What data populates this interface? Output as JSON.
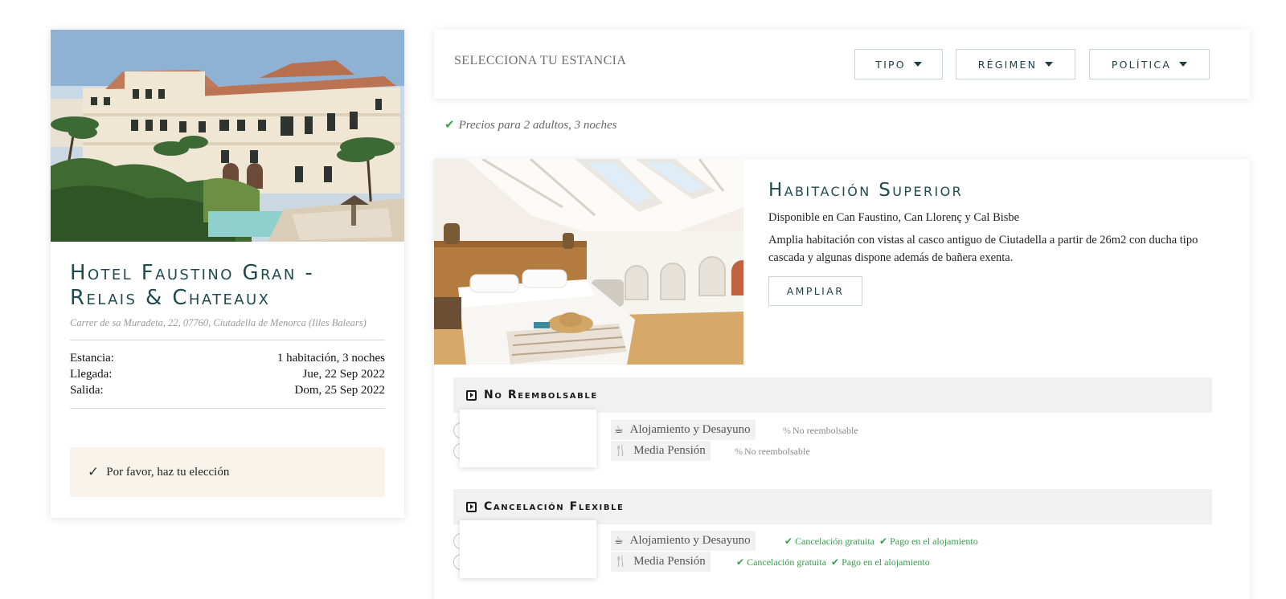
{
  "hotel": {
    "name_line1": "Hotel Faustino Gran -",
    "name_line2": "Relais & Chateaux",
    "address": "Carrer de sa Muradeta, 22, 07760, Ciutadella de Menorca (Illes Balears)",
    "stay": [
      {
        "label": "Estancia:",
        "value": "1 habitación, 3 noches"
      },
      {
        "label": "Llegada:",
        "value": "Jue, 22 Sep 2022"
      },
      {
        "label": "Salida:",
        "value": "Dom, 25 Sep 2022"
      }
    ],
    "choice_prompt": "Por favor, haz tu elección"
  },
  "selector": {
    "title": "SELECCIONA TU ESTANCIA",
    "filters": [
      "TIPO",
      "RÉGIMEN",
      "POLÍTICA"
    ]
  },
  "prices_note": "Precios para 2 adultos, 3 noches",
  "room": {
    "title": "Habitación Superior",
    "availability": "Disponible en Can Faustino, Can Llorenç y Cal Bisbe",
    "description": "Amplia habitación con vistas al casco antiguo de Ciutadella a partir de 26m2 con ducha tipo cascada y algunas dispone además de bañera exenta.",
    "expand_label": "AMPLIAR"
  },
  "policies": [
    {
      "title": "No Reembolsable",
      "rates": [
        {
          "meal": "Alojamiento y Desayuno",
          "icon": "coffee-icon",
          "conditions": [
            "No reembolsable"
          ]
        },
        {
          "meal": "Media Pensión",
          "icon": "cutlery-icon",
          "conditions": [
            "No reembolsable"
          ]
        }
      ]
    },
    {
      "title": "Cancelación Flexible",
      "rates": [
        {
          "meal": "Alojamiento y Desayuno",
          "icon": "coffee-icon",
          "conditions": [
            "Cancelación gratuita",
            "Pago en el alojamiento"
          ]
        },
        {
          "meal": "Media Pensión",
          "icon": "cutlery-icon",
          "conditions": [
            "Cancelación gratuita",
            "Pago en el alojamiento"
          ]
        }
      ]
    }
  ],
  "colors": {
    "accent": "#1f4a4e",
    "success": "#3a9a4d",
    "notice_bg": "#f8f4ec",
    "policy_header_bg": "#f1f1f1"
  }
}
